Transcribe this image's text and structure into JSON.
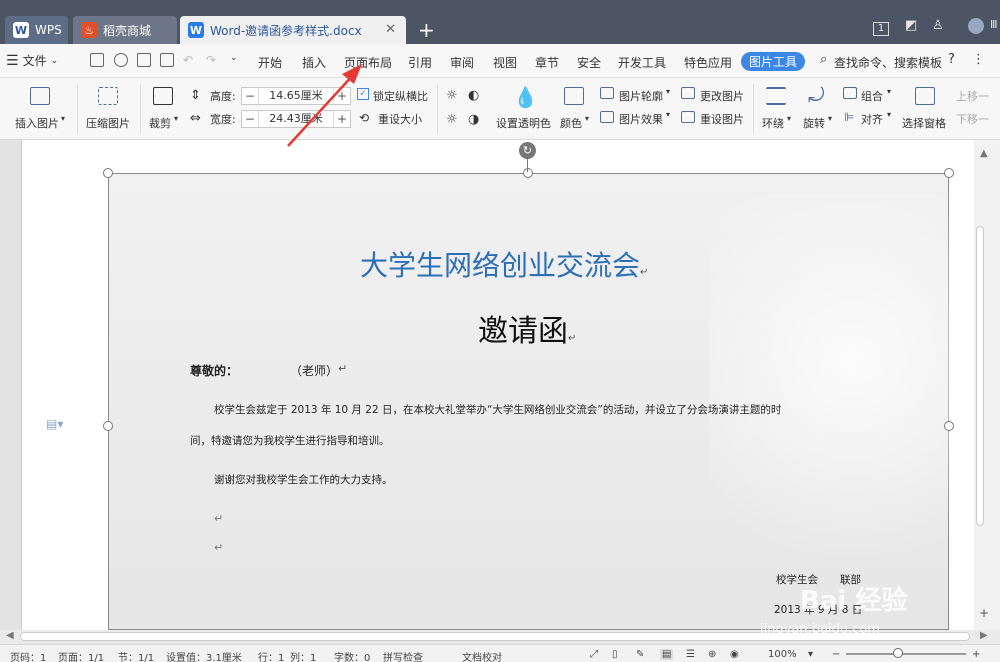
{
  "tabs": {
    "wps": "WPS",
    "store": "稻壳商城",
    "doc": "Word-邀请函参考样式.docx",
    "new_tab": "+",
    "badge": "1"
  },
  "menu": {
    "file": "文件",
    "items": [
      "开始",
      "插入",
      "页面布局",
      "引用",
      "审阅",
      "视图",
      "章节",
      "安全",
      "开发工具",
      "特色应用"
    ],
    "active_tool": "图片工具",
    "search": "查找命令、搜索模板",
    "help": "?",
    "more": "⋮"
  },
  "toolbar": {
    "insert_picture": "插入图片",
    "compress_picture": "压缩图片",
    "crop": "裁剪",
    "height_label": "高度:",
    "height_value": "14.65厘米",
    "width_label": "宽度:",
    "width_value": "24.43厘米",
    "minus": "−",
    "plus": "+",
    "lock_ratio": "锁定纵横比",
    "reset_size": "重设大小",
    "set_transparent": "设置透明色",
    "color": "颜色",
    "picture_outline": "图片轮廓",
    "picture_effect": "图片效果",
    "change_picture": "更改图片",
    "reset_picture": "重设图片",
    "wrap": "环绕",
    "rotate": "旋转",
    "group": "组合",
    "align": "对齐",
    "selection_pane": "选择窗格",
    "bring_forward": "上移一",
    "send_backward": "下移一"
  },
  "document": {
    "event_title": "大学生网络创业交流会",
    "invitation": "邀请函",
    "greeting": "尊敬的：",
    "teacher": "（老师）",
    "body_line1": "校学生会兹定于 2013 年 10 月 22 日，在本校大礼堂举办“大学生网络创业交流会”的活动，并设立了分会场演讲主题的时",
    "body_line2": "间，特邀请您为我校学生进行指导和培训。",
    "thanks": "谢谢您对我校学生会工作的大力支持。",
    "signature": "校学生会",
    "department": "联部",
    "date": "2013 年 9 月 8 日"
  },
  "status": {
    "page_num": "页码：1",
    "pages": "页面：1/1",
    "section": "节：1/1",
    "setting": "设置值：3.1厘米",
    "line": "行：1",
    "col": "列：1",
    "words": "字数：0",
    "spell": "拼写检查",
    "proof": "文档校对",
    "zoom": "100%"
  },
  "watermark": {
    "brand": "Bai 经验",
    "url": "jingyan.baidu.com"
  },
  "colors": {
    "accent": "#3c86e6",
    "title_blue": "#2c6fb7",
    "tab_bar": "#4b5563"
  }
}
